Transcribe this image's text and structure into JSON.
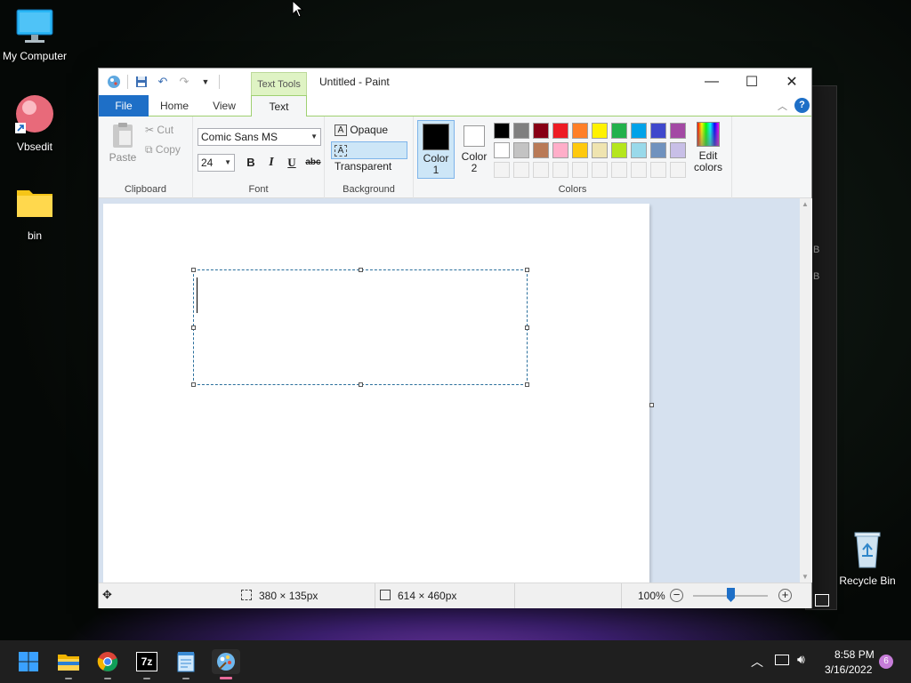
{
  "desktop": {
    "icons": [
      {
        "label": "My Computer"
      },
      {
        "label": "Vbsedit"
      },
      {
        "label": "bin"
      },
      {
        "label": "Recycle Bin"
      }
    ],
    "back_window_letters": [
      "B",
      "B"
    ]
  },
  "window": {
    "title": "Untitled - Paint",
    "context_tab": "Text Tools",
    "tabs": {
      "file": "File",
      "home": "Home",
      "view": "View",
      "text": "Text"
    }
  },
  "ribbon": {
    "clipboard": {
      "paste": "Paste",
      "cut": "Cut",
      "copy": "Copy",
      "label": "Clipboard"
    },
    "font": {
      "family": "Comic Sans MS",
      "size": "24",
      "bold": "B",
      "italic": "I",
      "underline": "U",
      "strike": "abc",
      "label": "Font"
    },
    "background": {
      "opaque": "Opaque",
      "transparent": "Transparent",
      "label": "Background"
    },
    "colors": {
      "color1_line1": "Color",
      "color1_line2": "1",
      "color2_line1": "Color",
      "color2_line2": "2",
      "edit_line1": "Edit",
      "edit_line2": "colors",
      "label": "Colors",
      "color1": "#000000",
      "color2": "#ffffff",
      "row1": [
        "#000000",
        "#7f7f7f",
        "#880015",
        "#ed1c24",
        "#ff7f27",
        "#fff200",
        "#22b14c",
        "#00a2e8",
        "#3f48cc",
        "#a349a4"
      ],
      "row2": [
        "#ffffff",
        "#c3c3c3",
        "#b97a57",
        "#ffaec9",
        "#ffc90e",
        "#efe4b0",
        "#b5e61d",
        "#99d9ea",
        "#7092be",
        "#c8bfe7"
      ]
    }
  },
  "status": {
    "selection_size": "380 × 135px",
    "image_size": "614 × 460px",
    "zoom": "100%"
  },
  "taskbar": {
    "time": "8:58 PM",
    "date": "3/16/2022",
    "notifications": "6",
    "app_7z": "7z"
  }
}
